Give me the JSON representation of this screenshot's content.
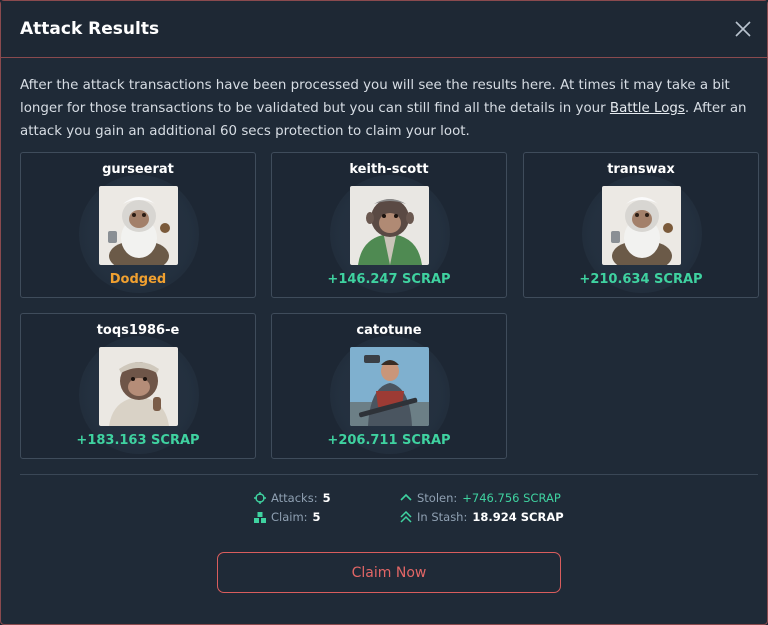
{
  "modal": {
    "title": "Attack Results",
    "description_before_link": "After the attack transactions have been processed you will see the results here. At times it may take a bit longer for those transactions to be validated but you can still find all the details in your ",
    "link_label": "Battle Logs",
    "description_after_link": ". After an attack you gain an additional 60 secs protection to claim your loot."
  },
  "targets": [
    {
      "name": "gurseerat",
      "result": "Dodged",
      "avatar": "old-monkey-icon"
    },
    {
      "name": "keith-scott",
      "result": "+146.247 SCRAP",
      "avatar": "monkey-jacket-icon"
    },
    {
      "name": "transwax",
      "result": "+210.634 SCRAP",
      "avatar": "old-monkey-icon"
    },
    {
      "name": "toqs1986-e",
      "result": "+183.163 SCRAP",
      "avatar": "monkey-bandana-icon"
    },
    {
      "name": "catotune",
      "result": "+206.711 SCRAP",
      "avatar": "soldier-icon"
    }
  ],
  "stats": {
    "attacks_label": "Attacks:",
    "attacks_value": "5",
    "claim_label": "Claim:",
    "claim_value": "5",
    "stolen_label": "Stolen:",
    "stolen_value": "+746.756 SCRAP",
    "stash_label": "In Stash:",
    "stash_value": "18.924 SCRAP"
  },
  "claim_button_label": "Claim Now",
  "colors": {
    "accent_red": "#e26666",
    "dodged": "#f0a030",
    "gain": "#3fd2a0"
  }
}
